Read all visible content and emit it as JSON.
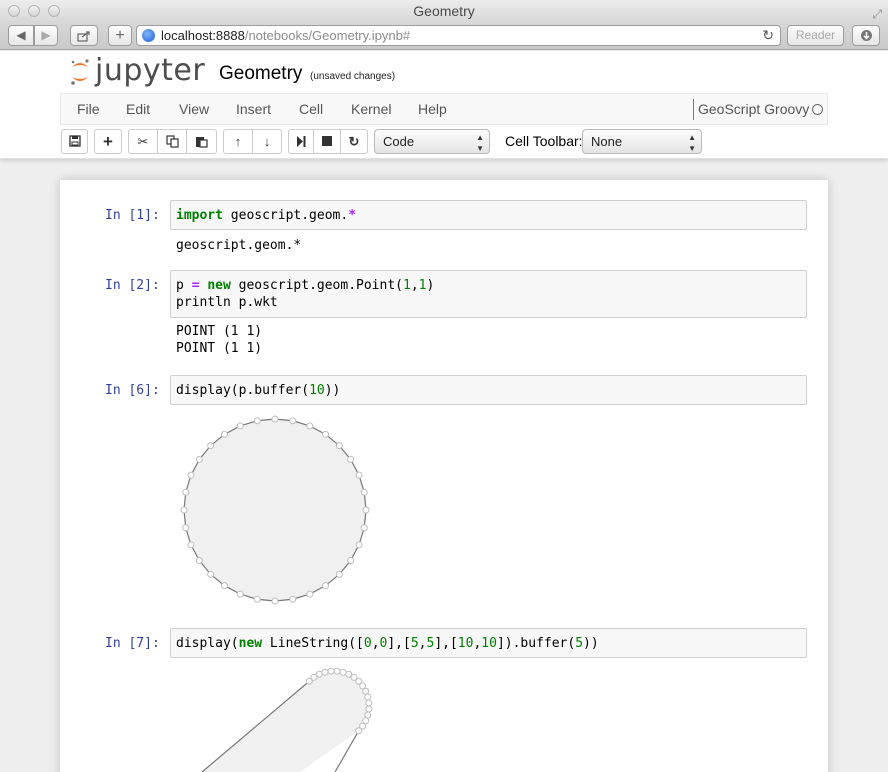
{
  "browser": {
    "window_title": "Geometry",
    "url_host": "localhost:8888",
    "url_path": "/notebooks/Geometry.ipynb#",
    "reader_label": "Reader"
  },
  "header": {
    "logo_text": "jupyter",
    "notebook_name": "Geometry",
    "save_status": "(unsaved changes)"
  },
  "menu": {
    "items": [
      "File",
      "Edit",
      "View",
      "Insert",
      "Cell",
      "Kernel",
      "Help"
    ],
    "kernel_name": "GeoScript Groovy"
  },
  "toolbar": {
    "cell_type": "Code",
    "cell_toolbar_label": "Cell Toolbar:",
    "cell_toolbar_value": "None"
  },
  "cells": [
    {
      "prompt": "In [1]:",
      "output": "geoscript.geom.*"
    },
    {
      "prompt": "In [2]:",
      "output": "POINT (1 1)\nPOINT (1 1)"
    },
    {
      "prompt": "In [6]:"
    },
    {
      "prompt": "In [7]:"
    }
  ],
  "colors": {
    "prompt": "#303f9f",
    "keyword": "#008000",
    "operator": "#aa22ff",
    "shape_fill": "#f0f0f0",
    "shape_stroke": "#777777"
  }
}
